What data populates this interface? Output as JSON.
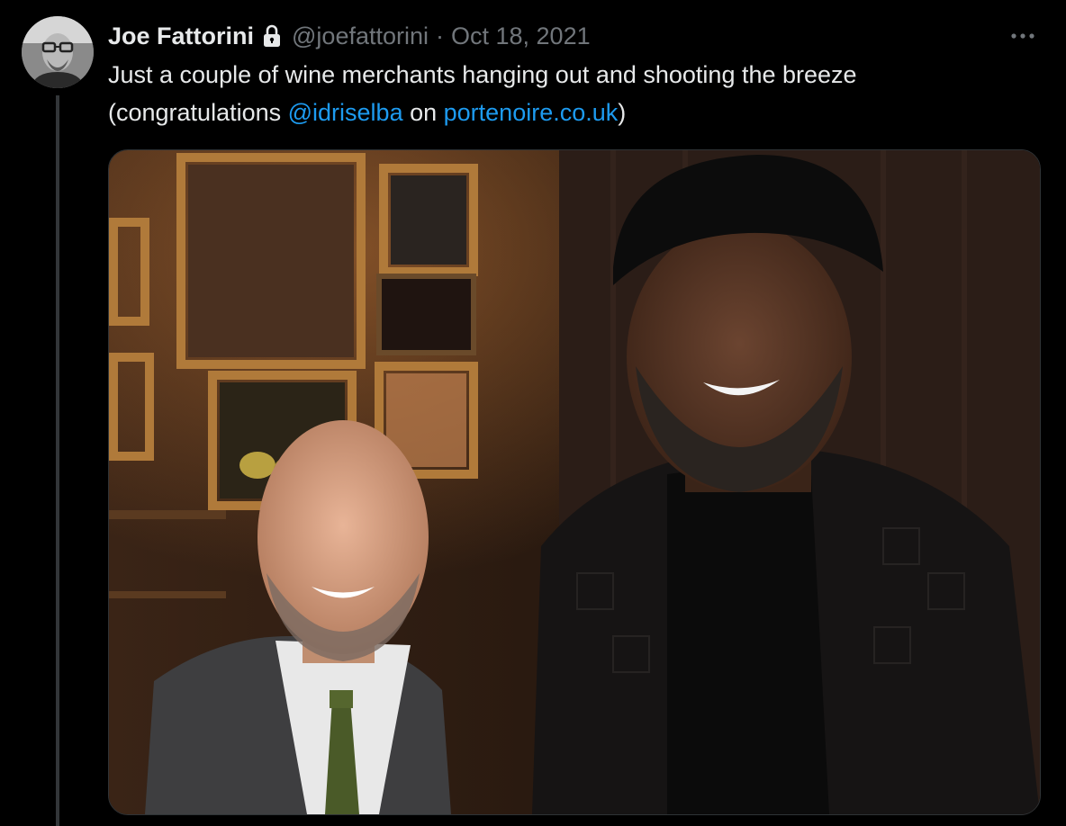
{
  "tweet": {
    "author_name": "Joe Fattorini",
    "handle": "@joefattorini",
    "separator": "·",
    "date": "Oct 18, 2021",
    "text_part1": "Just a couple of wine merchants hanging out and shooting the breeze (congratulations ",
    "mention": "@idriselba",
    "text_part2": " on ",
    "url": "portenoire.co.uk",
    "text_part3": ")",
    "protected_icon": "lock-icon",
    "more_icon": "more-dots-icon",
    "media_alt": "photo"
  },
  "colors": {
    "background": "#000000",
    "text": "#e7e9ea",
    "muted": "#71767b",
    "link": "#1d9bf0",
    "border": "#2f3336"
  }
}
